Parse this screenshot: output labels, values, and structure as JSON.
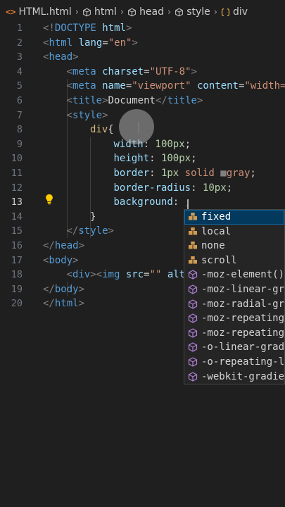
{
  "breadcrumb": [
    {
      "label": "HTML.html",
      "icon": "html-file-icon"
    },
    {
      "label": "html",
      "icon": "cube-icon"
    },
    {
      "label": "head",
      "icon": "cube-icon"
    },
    {
      "label": "style",
      "icon": "cube-icon"
    },
    {
      "label": "div",
      "icon": "brace-icon"
    }
  ],
  "editor": {
    "active_line": 13,
    "lines": [
      {
        "n": "1",
        "indent": 0,
        "tokens": [
          [
            "<!",
            "punct"
          ],
          [
            "DOCTYPE",
            "tag"
          ],
          [
            " html",
            "attr"
          ],
          [
            ">",
            "punct"
          ]
        ]
      },
      {
        "n": "2",
        "indent": 0,
        "tokens": [
          [
            "<",
            "punct"
          ],
          [
            "html",
            "tag"
          ],
          [
            " lang",
            "attr"
          ],
          [
            "=",
            "text"
          ],
          [
            "\"en\"",
            "str"
          ],
          [
            ">",
            "punct"
          ]
        ]
      },
      {
        "n": "3",
        "indent": 0,
        "tokens": [
          [
            "<",
            "punct"
          ],
          [
            "head",
            "tag"
          ],
          [
            ">",
            "punct"
          ]
        ]
      },
      {
        "n": "4",
        "indent": 1,
        "tokens": [
          [
            "<",
            "punct"
          ],
          [
            "meta",
            "tag"
          ],
          [
            " charset",
            "attr"
          ],
          [
            "=",
            "text"
          ],
          [
            "\"UTF-8\"",
            "str"
          ],
          [
            ">",
            "punct"
          ]
        ]
      },
      {
        "n": "5",
        "indent": 1,
        "tokens": [
          [
            "<",
            "punct"
          ],
          [
            "meta",
            "tag"
          ],
          [
            " name",
            "attr"
          ],
          [
            "=",
            "text"
          ],
          [
            "\"viewport\"",
            "str"
          ],
          [
            " content",
            "attr"
          ],
          [
            "=",
            "text"
          ],
          [
            "\"width=",
            "str"
          ]
        ]
      },
      {
        "n": "6",
        "indent": 1,
        "tokens": [
          [
            "<",
            "punct"
          ],
          [
            "title",
            "tag"
          ],
          [
            ">",
            "punct"
          ],
          [
            "Document",
            "text"
          ],
          [
            "</",
            "punct"
          ],
          [
            "title",
            "tag"
          ],
          [
            ">",
            "punct"
          ]
        ]
      },
      {
        "n": "7",
        "indent": 1,
        "tokens": [
          [
            "<",
            "punct"
          ],
          [
            "style",
            "tag"
          ],
          [
            ">",
            "punct"
          ]
        ]
      },
      {
        "n": "8",
        "indent": 2,
        "tokens": [
          [
            "div",
            "sel"
          ],
          [
            "{",
            "text"
          ]
        ]
      },
      {
        "n": "9",
        "indent": 3,
        "tokens": [
          [
            "width",
            "prop"
          ],
          [
            ": ",
            "text"
          ],
          [
            "100px",
            "num"
          ],
          [
            ";",
            "text"
          ]
        ]
      },
      {
        "n": "10",
        "indent": 3,
        "tokens": [
          [
            "height",
            "prop"
          ],
          [
            ": ",
            "text"
          ],
          [
            "100px",
            "num"
          ],
          [
            ";",
            "text"
          ]
        ]
      },
      {
        "n": "11",
        "indent": 3,
        "tokens": [
          [
            "border",
            "prop"
          ],
          [
            ": ",
            "text"
          ],
          [
            "1px",
            "num"
          ],
          [
            " solid ",
            "val"
          ],
          [
            "■",
            "swatch"
          ],
          [
            "gray",
            "val"
          ],
          [
            ";",
            "text"
          ]
        ]
      },
      {
        "n": "12",
        "indent": 3,
        "tokens": [
          [
            "border-radius",
            "prop"
          ],
          [
            ": ",
            "text"
          ],
          [
            "10px",
            "num"
          ],
          [
            ";",
            "text"
          ]
        ]
      },
      {
        "n": "13",
        "indent": 3,
        "tokens": [
          [
            "background",
            "prop"
          ],
          [
            ": ",
            "text"
          ],
          [
            ";",
            "text"
          ]
        ]
      },
      {
        "n": "14",
        "indent": 2,
        "tokens": [
          [
            "}",
            "text"
          ]
        ]
      },
      {
        "n": "15",
        "indent": 1,
        "tokens": [
          [
            "</",
            "punct"
          ],
          [
            "style",
            "tag"
          ],
          [
            ">",
            "punct"
          ]
        ]
      },
      {
        "n": "16",
        "indent": 0,
        "tokens": [
          [
            "</",
            "punct"
          ],
          [
            "head",
            "tag"
          ],
          [
            ">",
            "punct"
          ]
        ]
      },
      {
        "n": "17",
        "indent": 0,
        "tokens": [
          [
            "<",
            "punct"
          ],
          [
            "body",
            "tag"
          ],
          [
            ">",
            "punct"
          ]
        ]
      },
      {
        "n": "18",
        "indent": 1,
        "tokens": [
          [
            "<",
            "punct"
          ],
          [
            "div",
            "tag"
          ],
          [
            ">",
            "punct"
          ],
          [
            "<",
            "punct"
          ],
          [
            "img",
            "tag"
          ],
          [
            " src",
            "attr"
          ],
          [
            "=",
            "text"
          ],
          [
            "\"\"",
            "str"
          ],
          [
            " alt",
            "attr"
          ]
        ]
      },
      {
        "n": "19",
        "indent": 0,
        "tokens": [
          [
            "</",
            "punct"
          ],
          [
            "body",
            "tag"
          ],
          [
            ">",
            "punct"
          ]
        ]
      },
      {
        "n": "20",
        "indent": 0,
        "tokens": [
          [
            "</",
            "punct"
          ],
          [
            "html",
            "tag"
          ],
          [
            ">",
            "punct"
          ]
        ]
      }
    ]
  },
  "suggestions": [
    {
      "label": "fixed",
      "icon": "value-icon",
      "selected": true
    },
    {
      "label": "local",
      "icon": "value-icon",
      "selected": false
    },
    {
      "label": "none",
      "icon": "value-icon",
      "selected": false
    },
    {
      "label": "scroll",
      "icon": "value-icon",
      "selected": false
    },
    {
      "label": "-moz-element()",
      "icon": "function-cube-icon",
      "selected": false
    },
    {
      "label": "-moz-linear-gra",
      "icon": "function-cube-icon",
      "selected": false
    },
    {
      "label": "-moz-radial-gra",
      "icon": "function-cube-icon",
      "selected": false
    },
    {
      "label": "-moz-repeating",
      "icon": "function-cube-icon",
      "selected": false
    },
    {
      "label": "-moz-repeating",
      "icon": "function-cube-icon",
      "selected": false
    },
    {
      "label": "-o-linear-gradi",
      "icon": "function-cube-icon",
      "selected": false
    },
    {
      "label": "-o-repeating-li",
      "icon": "function-cube-icon",
      "selected": false
    },
    {
      "label": "-webkit-gradier",
      "icon": "function-cube-icon",
      "selected": false
    }
  ],
  "colors": {
    "background": "#1f1f1f",
    "tag": "#569cd6",
    "attribute": "#9cdcfe",
    "string": "#ce9178",
    "selector": "#d7ba7d",
    "number": "#b5cea8",
    "suggest_selected": "#04395e",
    "value_icon": "#d19a50",
    "function_icon": "#b180d7",
    "lightbulb": "#ffcc00"
  }
}
